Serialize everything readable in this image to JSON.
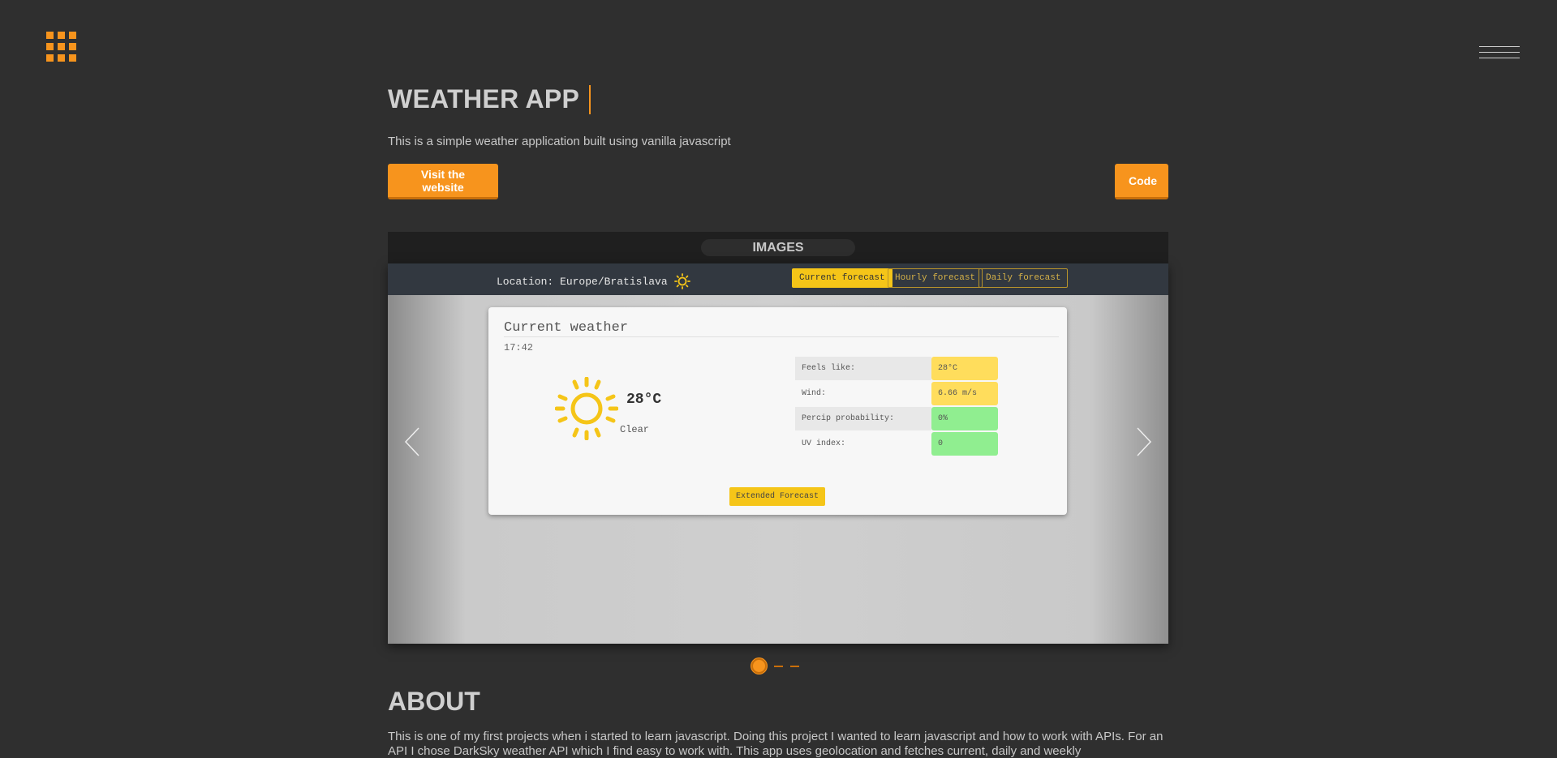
{
  "header": {
    "grid_menu_icon": "grid-menu-icon",
    "hamburger_icon": "hamburger-icon"
  },
  "project": {
    "title": "WEATHER APP",
    "subtitle": "This is a simple weather application built using vanilla javascript",
    "visit_label": "Visit the website",
    "code_label": "Code"
  },
  "gallery": {
    "label": "IMAGES",
    "slide": {
      "location": "Location: Europe/Bratislava",
      "tabs": [
        "Current forecast",
        "Hourly forecast",
        "Daily forecast"
      ],
      "active_tab": 0,
      "card_title": "Current weather",
      "time": "17:42",
      "temperature": "28°C",
      "condition": "Clear",
      "stats": [
        {
          "label": "Feels like:",
          "value": "28°C",
          "color": "yellow"
        },
        {
          "label": "Wind:",
          "value": "6.66 m/s",
          "color": "yellow"
        },
        {
          "label": "Percip probability:",
          "value": "0%",
          "color": "green"
        },
        {
          "label": "UV index:",
          "value": "0",
          "color": "green"
        }
      ],
      "extended_label": "Extended Forecast"
    },
    "slide_count": 3,
    "active_slide": 0
  },
  "about": {
    "title": "ABOUT",
    "text": "This is one of my first projects when i started to learn javascript. Doing this project I wanted to learn javascript and how to work with APIs. For an API I chose DarkSky weather API which I find easy to work with. This app uses geolocation and fetches current, daily and weekly"
  },
  "colors": {
    "accent": "#f7941d",
    "background": "#2f2f2f",
    "app_yellow": "#f5c518"
  }
}
